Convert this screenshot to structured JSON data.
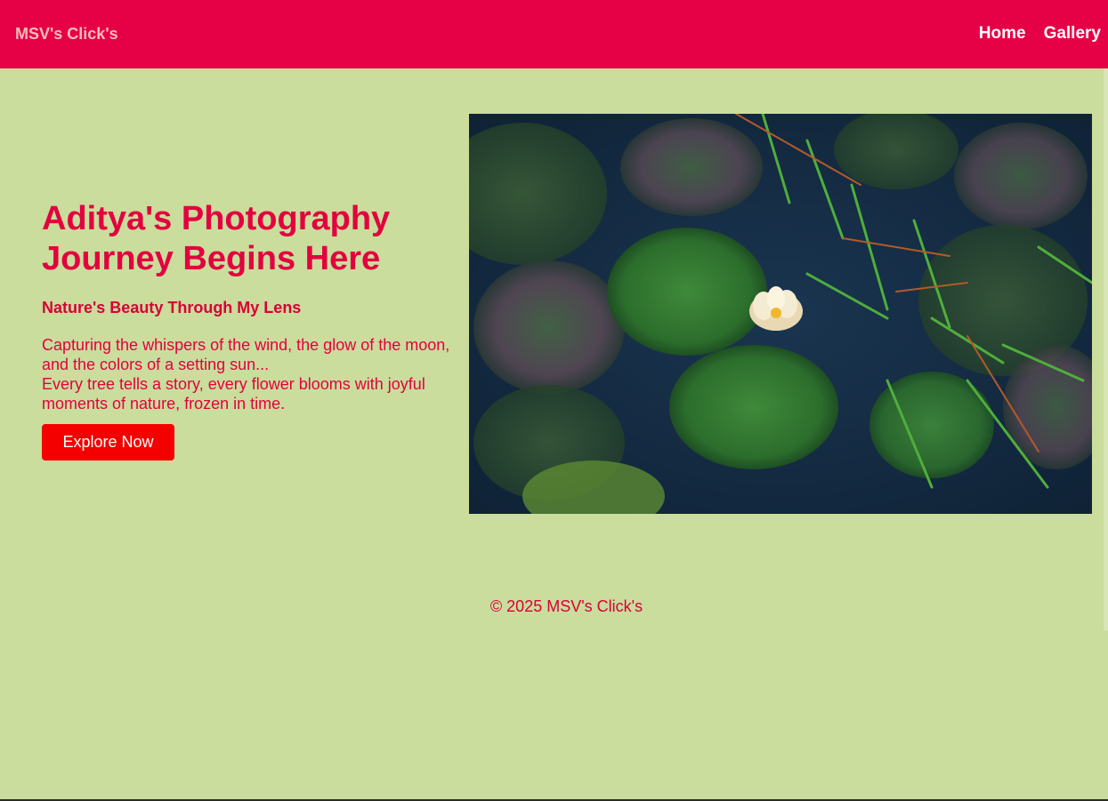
{
  "navbar": {
    "brand": "MSV's Click's",
    "links": [
      {
        "label": "Home"
      },
      {
        "label": "Gallery"
      }
    ]
  },
  "hero": {
    "title_line1": "Aditya's Photography",
    "title_line2": "Journey Begins Here",
    "subtitle": "Nature's Beauty Through My Lens",
    "description_line1": "Capturing the whispers of the wind, the glow of the moon, and the colors of a setting sun...",
    "description_line2": "Every tree tells a story, every flower blooms with joyful moments of nature, frozen in time.",
    "cta_label": "Explore Now",
    "photo_subject": "water-lily-pond-photo"
  },
  "footer": {
    "copyright": "© 2025 MSV's Click's"
  },
  "colors": {
    "page_background": "#cadd9c",
    "navbar_background": "#e60045",
    "accent_text": "#e3003f",
    "button_background": "#f50000"
  }
}
